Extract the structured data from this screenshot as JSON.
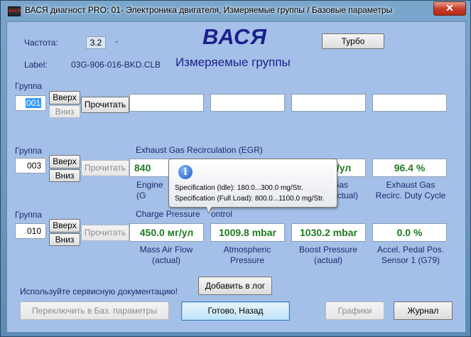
{
  "window": {
    "title": "ВАСЯ диагност PRO: 01- Электроника двигателя,  Измеряемые группы / Базовые параметры",
    "close_glyph": "✕",
    "app_icon_text": "ВАСЯ"
  },
  "header": {
    "freq_label": "Частота:",
    "freq_value": "3.2",
    "freq_dash": "-",
    "brand": "ВАСЯ",
    "label_label": "Label:",
    "label_value": "03G-906-016-BKD.CLB",
    "subtitle": "Измеряемые группы",
    "turbo_button": "Турбо"
  },
  "group_label": "Группа",
  "buttons": {
    "up": "Вверх",
    "down": "Вниз",
    "read": "Прочитать"
  },
  "groups": [
    {
      "number": "001",
      "title": "",
      "values": [
        "",
        "",
        "",
        ""
      ],
      "captions": [
        "",
        "",
        "",
        ""
      ]
    },
    {
      "number": "003",
      "title": "Exhaust Gas Recirculation (EGR)",
      "values": [
        "840",
        "",
        "г/ул",
        "96.4 %"
      ],
      "captions": [
        "Engine\n(G",
        "",
        "Gas\nactual)",
        "Exhaust Gas\nRecirc. Duty Cycle"
      ]
    },
    {
      "number": "010",
      "title": "Charge Pressure",
      "title_tail": "ontrol",
      "values": [
        "450.0 мг/ул",
        "1009.8 mbar",
        "1030.2 mbar",
        "0.0 %"
      ],
      "captions": [
        "Mass Air Flow\n(actual)",
        "Atmospheric\nPressure",
        "Boost Pressure\n(actual)",
        "Accel. Pedal Pos.\nSensor 1 (G79)"
      ]
    }
  ],
  "tooltip": {
    "icon": "i",
    "line1": "Specification (Idle): 180.0...300.0 mg/Str.",
    "line2": "Specification (Full Load): 800.0...1100.0 mg/Str."
  },
  "footer": {
    "service_note": "Используйте сервисную документацию!",
    "add_log": "Добавить в лог",
    "switch_basic": "Переключить в Баз. параметры",
    "done_back": "Готово, Назад",
    "graphs": "Графики",
    "journal": "Журнал"
  }
}
